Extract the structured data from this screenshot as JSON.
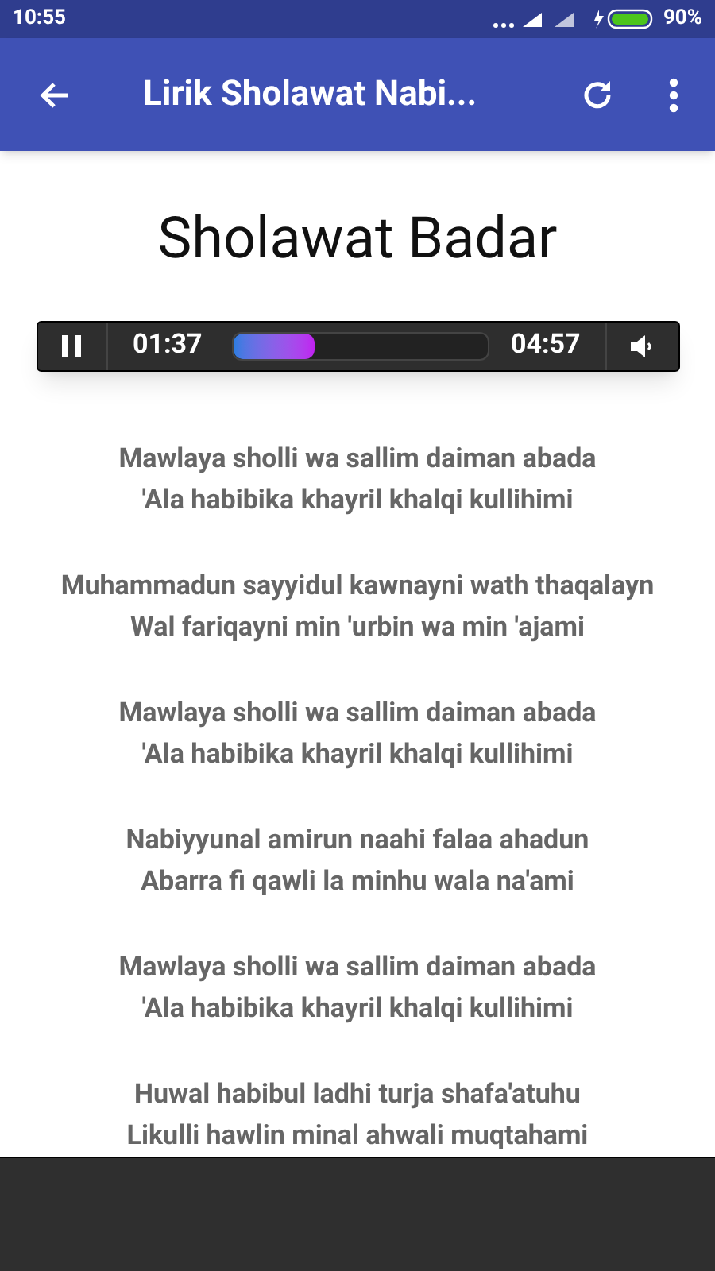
{
  "status_bar": {
    "time": "10:55",
    "battery": "90%"
  },
  "app_bar": {
    "title": "Lirik Sholawat Nabi..."
  },
  "song_title": "Sholawat Badar",
  "player": {
    "elapsed": "01:37",
    "total": "04:57",
    "level": 0.32,
    "playing": true
  },
  "stanzas": [
    [
      "Mawlaya sholli wa sallim daiman abada",
      "'Ala habibika khayril khalqi kullihimi"
    ],
    [
      "Muhammadun sayyidul kawnayni wath thaqalayn",
      "Wal fariqayni min 'urbin wa min 'ajami"
    ],
    [
      "Mawlaya sholli wa sallim daiman abada",
      "'Ala habibika khayril khalqi kullihimi"
    ],
    [
      "Nabiyyunal amirun naahi falaa ahadun",
      "Abarra fi qawli la minhu wala na'ami"
    ],
    [
      "Mawlaya sholli wa sallim daiman abada",
      "'Ala habibika khayril khalqi kullihimi"
    ],
    [
      "Huwal habibul ladhi turja shafa'atuhu",
      "Likulli hawlin minal ahwali muqtahami"
    ]
  ]
}
